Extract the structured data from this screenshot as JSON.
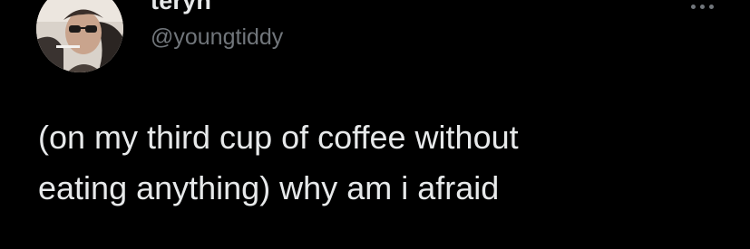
{
  "tweet": {
    "author": {
      "display_name": "teryn",
      "handle": "@youngtiddy",
      "avatar_icon": "profile-photo"
    },
    "more_icon": "more-options-icon",
    "text": "(on my third cup of coffee without\neating anything) why am i afraid"
  },
  "colors": {
    "background": "#000000",
    "primary_text": "#e7e9ea",
    "secondary_text": "#71767b"
  }
}
